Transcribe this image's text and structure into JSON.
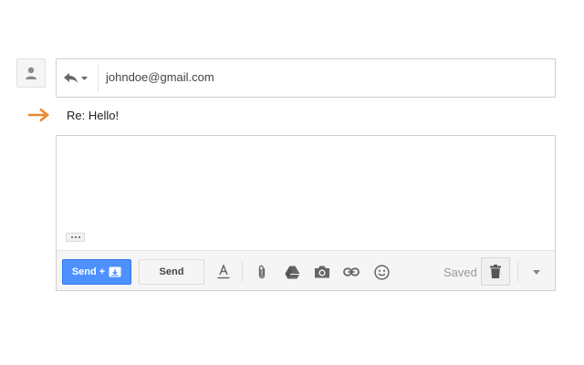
{
  "recipient": {
    "email": "johndoe@gmail.com"
  },
  "subject": {
    "text": "Re: Hello!"
  },
  "toolbar": {
    "send_plus_label": "Send +",
    "send_label": "Send",
    "saved_label": "Saved"
  },
  "colors": {
    "accent_blue": "#4d90fe",
    "arrow_orange": "#e8892b",
    "icon_gray": "#666666"
  },
  "icons": {
    "avatar": "person-icon",
    "reply": "reply-icon",
    "arrow": "arrow-right-icon",
    "send_plus": "archive-icon",
    "formatting": "text-format-icon",
    "attach": "paperclip-icon",
    "drive": "drive-icon",
    "photo": "camera-icon",
    "link": "link-icon",
    "emoji": "smiley-icon",
    "discard": "trash-icon",
    "more": "chevron-down-icon"
  }
}
